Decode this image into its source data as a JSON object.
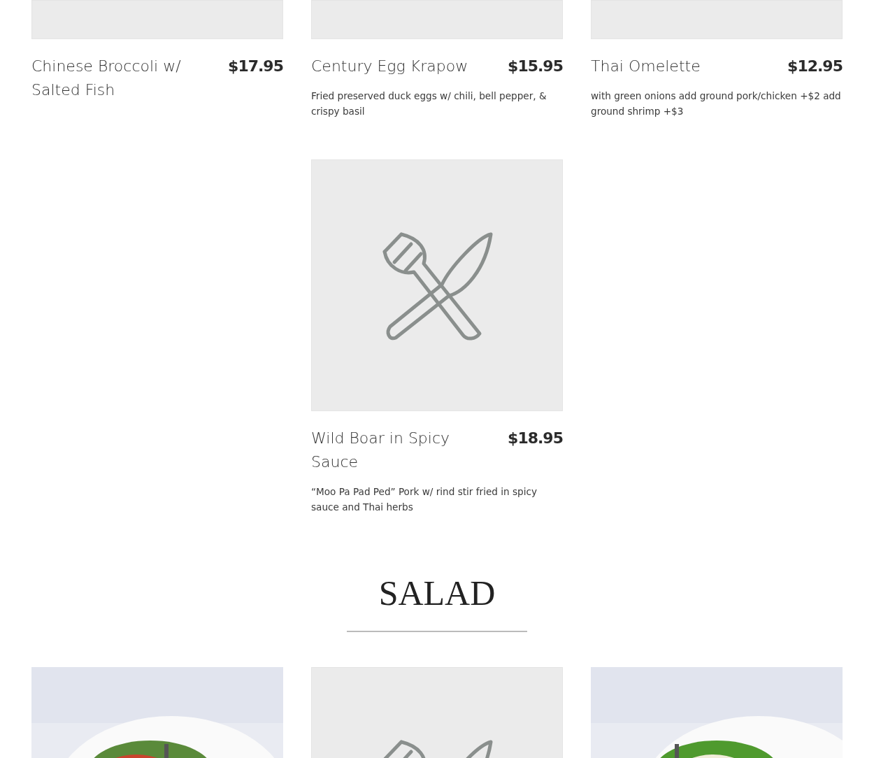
{
  "sections": [
    {
      "items": [
        {
          "image": {
            "kind": "blank"
          },
          "name": "Chinese Broccoli w/ Salted Fish",
          "price": "$17.95"
        },
        {
          "image": {
            "kind": "blank"
          },
          "name": "Century Egg Krapow",
          "price": "$15.95",
          "description": "Fried preserved duck eggs w/ chili, bell pepper, & crispy basil"
        },
        {
          "image": {
            "kind": "blank"
          },
          "name": "Thai Omelette",
          "price": "$12.95",
          "description": "with green onions add ground pork/chicken +$2 add ground shrimp +$3"
        },
        {
          "image": {
            "kind": "empty"
          }
        },
        {
          "image": {
            "kind": "placeholder"
          },
          "name": "Wild Boar in Spicy Sauce",
          "price": "$18.95",
          "description": "“Moo Pa Pad Ped” Pork w/ rind stir fried in spicy sauce and Thai herbs"
        }
      ]
    },
    {
      "heading": "SALAD",
      "items": [
        {
          "image": {
            "kind": "picture"
          }
        },
        {
          "image": {
            "kind": "placeholder"
          }
        },
        {
          "image": {
            "kind": "picture"
          }
        }
      ]
    }
  ]
}
